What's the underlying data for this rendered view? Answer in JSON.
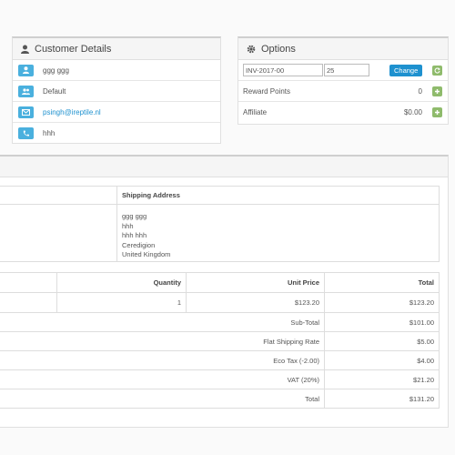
{
  "customer": {
    "title": "Customer Details",
    "rows": [
      {
        "icon": "user-icon",
        "value": "ggg ggg"
      },
      {
        "icon": "users-icon",
        "value": "Default"
      },
      {
        "icon": "envelope-icon",
        "value": "psingh@ireptile.nl"
      },
      {
        "icon": "phone-icon",
        "value": "hhh"
      }
    ]
  },
  "options": {
    "title": "Options",
    "invoice_prefix": "INV-2017-00",
    "invoice_number": "25",
    "change_label": "Change",
    "reward_label": "Reward Points",
    "reward_value": "0",
    "affiliate_label": "Affiliate",
    "affiliate_value": "$0.00"
  },
  "shipping": {
    "header": "Shipping Address",
    "lines": [
      "ggg ggg",
      "hhh",
      "hhh hhh",
      "Ceredigion",
      "United Kingdom"
    ]
  },
  "products": {
    "headers": {
      "quantity": "Quantity",
      "unit_price": "Unit Price",
      "total": "Total"
    },
    "row": {
      "quantity": "1",
      "unit_price": "$123.20",
      "total": "$123.20"
    }
  },
  "totals": [
    {
      "label": "Sub-Total",
      "value": "$101.00"
    },
    {
      "label": "Flat Shipping Rate",
      "value": "$5.00"
    },
    {
      "label": "Eco Tax (-2.00)",
      "value": "$4.00"
    },
    {
      "label": "VAT (20%)",
      "value": "$21.20"
    },
    {
      "label": "Total",
      "value": "$131.20"
    }
  ],
  "colors": {
    "accent": "#1e91cf",
    "badge": "#4ab0de",
    "success": "#8fbb6c"
  }
}
